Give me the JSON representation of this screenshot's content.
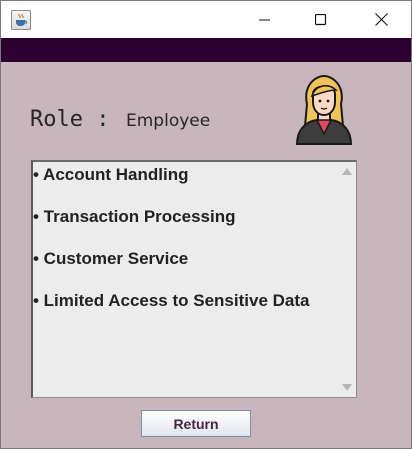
{
  "window": {
    "app_icon": "java-cup-icon",
    "controls": [
      "minimize-icon",
      "maximize-icon",
      "close-icon"
    ]
  },
  "colors": {
    "banner": "#2d0030",
    "background": "#c9b6bd",
    "button_text": "#4a2545"
  },
  "role": {
    "label": "Role :",
    "value": "Employee",
    "avatar_icon": "female-employee-avatar-icon"
  },
  "permissions": {
    "items": [
      "• Account Handling",
      "• Transaction Processing",
      "• Customer Service",
      "• Limited Access to Sensitive Data"
    ]
  },
  "actions": {
    "return_label": "Return"
  }
}
